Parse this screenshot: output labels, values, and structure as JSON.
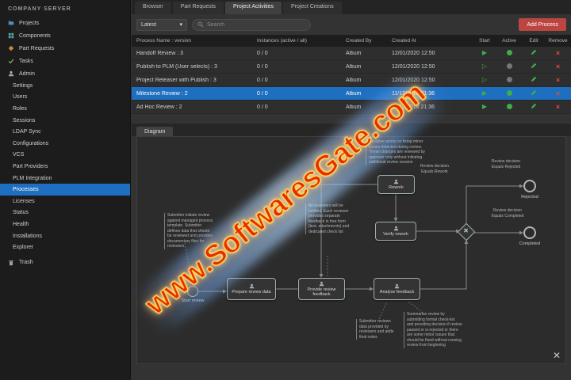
{
  "sidebar": {
    "title": "COMPANY SERVER",
    "top_items": [
      {
        "label": "Projects"
      },
      {
        "label": "Components"
      },
      {
        "label": "Part Requests"
      },
      {
        "label": "Tasks"
      },
      {
        "label": "Admin"
      }
    ],
    "admin_items": [
      {
        "label": "Settings"
      },
      {
        "label": "Users"
      },
      {
        "label": "Roles"
      },
      {
        "label": "Sessions"
      },
      {
        "label": "LDAP Sync"
      },
      {
        "label": "Configurations"
      },
      {
        "label": "VCS"
      },
      {
        "label": "Part Providers"
      },
      {
        "label": "PLM Integration"
      },
      {
        "label": "Processes",
        "selected": true
      },
      {
        "label": "Licenses"
      },
      {
        "label": "Status"
      },
      {
        "label": "Health"
      },
      {
        "label": "Installations"
      },
      {
        "label": "Explorer"
      }
    ],
    "trash_label": "Trash"
  },
  "tabs": [
    {
      "label": "Browser",
      "active": false
    },
    {
      "label": "Part Requests",
      "active": false
    },
    {
      "label": "Project Activities",
      "active": true
    },
    {
      "label": "Project Creations",
      "active": false
    }
  ],
  "toolbar": {
    "filter_value": "Latest",
    "search_placeholder": "Search",
    "add_process_label": "Add Process"
  },
  "table": {
    "headers": {
      "name": "Process Name : version",
      "instances": "Instances (active / all)",
      "created_by": "Created By",
      "created_at": "Created At",
      "start": "Start",
      "active": "Active",
      "edit": "Edit",
      "remove": "Remove"
    },
    "rows": [
      {
        "name": "Handoff Review : 3",
        "instances": "0 / 0",
        "created_by": "Altium",
        "created_at": "12/01/2020 12:50",
        "active": true,
        "selected": false
      },
      {
        "name": "Publish to PLM (User selects) : 3",
        "instances": "0 / 0",
        "created_by": "Altium",
        "created_at": "12/01/2020 12:50",
        "active": false,
        "selected": false
      },
      {
        "name": "Project Releaser with Publish : 3",
        "instances": "0 / 0",
        "created_by": "Altium",
        "created_at": "12/01/2020 12:50",
        "active": false,
        "selected": false
      },
      {
        "name": "Milestone Review : 2",
        "instances": "0 / 0",
        "created_by": "Altium",
        "created_at": "11/13/2018 21:36",
        "active": true,
        "selected": true
      },
      {
        "name": "Ad Hoc Review : 2",
        "instances": "0 / 0",
        "created_by": "Altium",
        "created_at": "11/13/2018 21:36",
        "active": true,
        "selected": false
      }
    ]
  },
  "diagram": {
    "tab_label": "Diagram",
    "nodes": {
      "start_label": "Start review",
      "prepare": "Prepare review data",
      "provide": "Provide review feedback",
      "analyse": "Analyse feedback",
      "rework": "Rework",
      "verify": "Verify rework",
      "rejected": "Rejected",
      "completed": "Completed"
    },
    "annotations": {
      "submitter": "Submitter initiate review against managed process template. Submitter defines data that should be reviewed and provides documentary files for reviewers",
      "reviewers": "All reviewers will be notified. Each reviewer provides separate feedback in free form (text, attachments) and dedicated check list",
      "designer": "Designer works on fixing minor issues detected during review. These changes are reviewed by approver only without initiating additional review session",
      "decision_rework": "Review decision Equals Rework",
      "decision_rejected": "Review decision Equals Rejected",
      "decision_completed": "Review decision Equals Completed",
      "submitter_reviews": "Submitter reviews data provided by reviewers and adds final notes",
      "summarise": "Summarise review by submitting formal check-list and providing decision if review passed or is rejected or there are some minor issues that should be fixed without running review from beginning"
    }
  },
  "watermark": {
    "text": "www.SoftwaresGate.com"
  },
  "colors": {
    "accent_blue": "#1f6fc0",
    "button_red": "#bb4540",
    "icon_green": "#3fae49",
    "icon_red": "#e04b3f"
  }
}
